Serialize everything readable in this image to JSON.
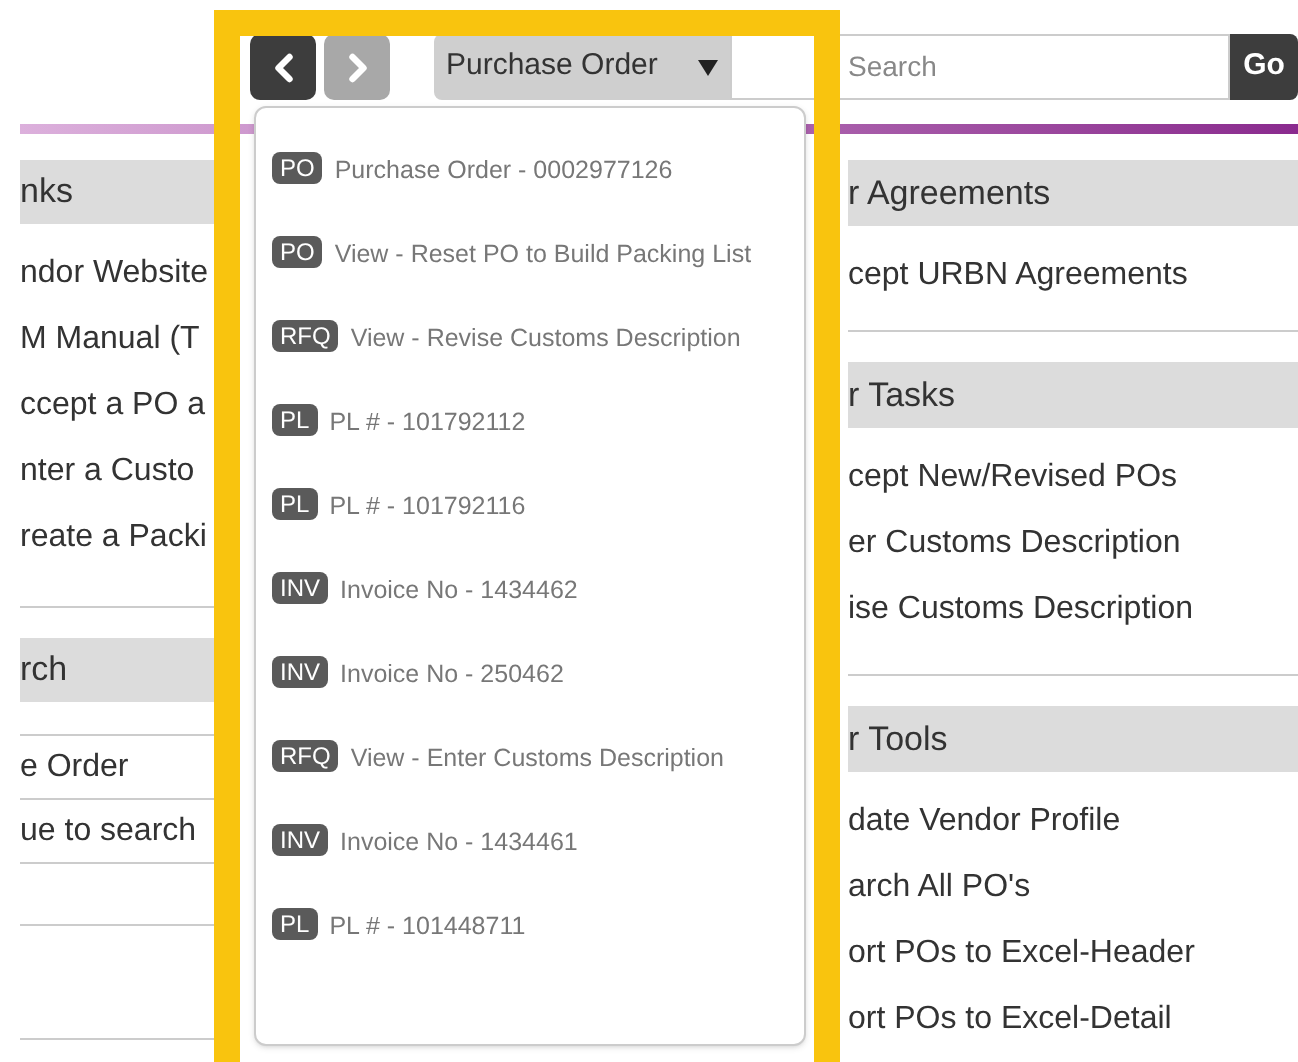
{
  "nav": {
    "back": {
      "disabled": false
    },
    "forward": {
      "disabled": true
    }
  },
  "search": {
    "type": "Purchase Order",
    "placeholder": "Search",
    "go": "Go"
  },
  "left_column": [
    {
      "title": "nks",
      "items": [
        "ndor Website",
        "M Manual (T",
        "ccept a PO a",
        "nter a Custo",
        "reate a Packi"
      ]
    },
    {
      "title": "rch",
      "items": [
        "e Order",
        "ue to search"
      ]
    }
  ],
  "right_column": [
    {
      "title": "r Agreements",
      "items": [
        "cept URBN Agreements"
      ]
    },
    {
      "title": "r Tasks",
      "items": [
        "cept New/Revised POs",
        "er Customs Description",
        "ise Customs Description"
      ]
    },
    {
      "title": "r Tools",
      "items": [
        "date Vendor Profile",
        "arch All PO's",
        "ort POs to Excel-Header",
        "ort POs to Excel-Detail"
      ]
    }
  ],
  "dropdown": [
    {
      "badge": "PO",
      "text": "Purchase Order - 0002977126"
    },
    {
      "badge": "PO",
      "text": "View - Reset PO to Build Packing List"
    },
    {
      "badge": "RFQ",
      "text": "View - Revise Customs Description"
    },
    {
      "badge": "PL",
      "text": "PL # - 101792112"
    },
    {
      "badge": "PL",
      "text": "PL # - 101792116"
    },
    {
      "badge": "INV",
      "text": "Invoice No - 1434462"
    },
    {
      "badge": "INV",
      "text": "Invoice No - 250462"
    },
    {
      "badge": "RFQ",
      "text": "View - Enter Customs Description"
    },
    {
      "badge": "INV",
      "text": "Invoice No - 1434461"
    },
    {
      "badge": "PL",
      "text": "PL # - 101448711"
    }
  ]
}
